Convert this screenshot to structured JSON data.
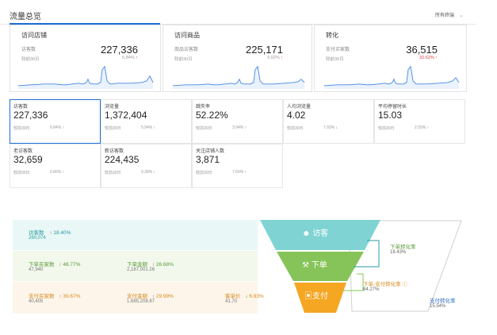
{
  "header": {
    "title": "流量总览",
    "channel_select": "所有终端"
  },
  "cards": [
    {
      "title": "访问店铺",
      "metric": "访客数",
      "value": "227,336",
      "prev": "较前30日",
      "change": "6.84%",
      "dir": "up"
    },
    {
      "title": "访问商品",
      "metric": "商品访客数",
      "value": "225,171",
      "prev": "较前30日",
      "change": "9.02%",
      "dir": "up"
    },
    {
      "title": "转化",
      "metric": "支付买家数",
      "value": "36,515",
      "prev": "较前30日",
      "change": "32.62%",
      "dir": "up"
    }
  ],
  "tiles": [
    {
      "label": "访客数",
      "value": "227,336",
      "prev": "较前30日",
      "change": "6.84%",
      "dir": "up"
    },
    {
      "label": "浏览量",
      "value": "1,372,404",
      "prev": "较前30日",
      "change": "5.94%",
      "dir": "up"
    },
    {
      "label": "跳失率",
      "value": "52.22%",
      "prev": "较前30日",
      "change": "3.94%",
      "dir": "up"
    },
    {
      "label": "人均浏览量",
      "value": "4.02",
      "prev": "较前30日",
      "change": "7.93%",
      "dir": "down"
    },
    {
      "label": "平均停留时长",
      "value": "15.03",
      "prev": "较前30日",
      "change": "2.55%",
      "dir": "up"
    },
    {
      "label": "老访客数",
      "value": "32,659",
      "prev": "较前30日",
      "change": "6.86%",
      "dir": "up"
    },
    {
      "label": "新访客数",
      "value": "224,435",
      "prev": "较前30日",
      "change": "9.38%",
      "dir": "up"
    },
    {
      "label": "关注店铺人数",
      "value": "3,871",
      "prev": "较前30日",
      "change": "7.65%",
      "dir": "up"
    }
  ],
  "funnel": {
    "row1": {
      "label": "访客数",
      "change": "18.40%",
      "value": "260,074"
    },
    "row2": [
      {
        "label": "下单买家数",
        "change": "46.77%",
        "value": "47,940"
      },
      {
        "label": "下单金额",
        "change": "26.68%",
        "value": "2,187,001.26"
      }
    ],
    "row3": [
      {
        "label": "支付买家数",
        "change": "39.67%",
        "value": "40,405"
      },
      {
        "label": "支付金额",
        "change": "29.99%",
        "value": "1,685,208.87"
      },
      {
        "label": "客单价",
        "change": "6.93%",
        "value": "41.70",
        "dir": "down"
      }
    ],
    "stages": {
      "visit": "访客",
      "order": "下单",
      "pay": "支付"
    },
    "rates": {
      "order_rate_label": "下单转化率",
      "order_rate": "18.43%",
      "order_pay_label": "下单-支付转化率",
      "order_pay": "84.27%",
      "pay_rate_label": "支付转化率",
      "pay_rate": "15.54%"
    }
  },
  "colors": {
    "accent": "#1f6fd8",
    "up": "#e0393e",
    "down": "#2f9a3c",
    "teal": "#7fd3d3",
    "green": "#86c45a",
    "orange": "#f5a623"
  }
}
